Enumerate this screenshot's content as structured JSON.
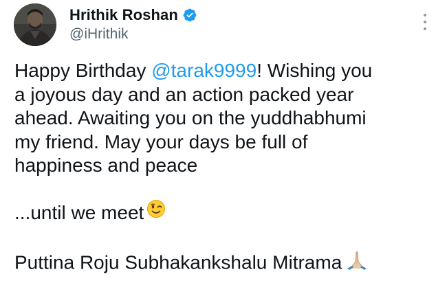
{
  "author": {
    "display_name": "Hrithik Roshan",
    "handle": "@iHrithik",
    "verified_color": "#1d9bf0"
  },
  "tweet": {
    "line1_pre": "Happy Birthday ",
    "line1_mention": "@tarak9999",
    "line1_post": "! Wishing you",
    "line2": "a joyous day and an action packed year",
    "line3": "ahead. Awaiting you on the yuddhabhumi",
    "line4": "my friend. May your days be full of",
    "line5": "happiness and peace",
    "line6": "...until we meet",
    "line7": "Puttina Roju Subhakankshalu Mitrama"
  },
  "icons": {
    "avatar": "profile-photo",
    "verified": "verified-badge-icon",
    "more": "more-options-icon",
    "wink": "winking-face-emoji",
    "pray": "folded-hands-emoji"
  },
  "colors": {
    "mention": "#1d9bf0",
    "handle": "#536471",
    "text": "#0f1419"
  }
}
